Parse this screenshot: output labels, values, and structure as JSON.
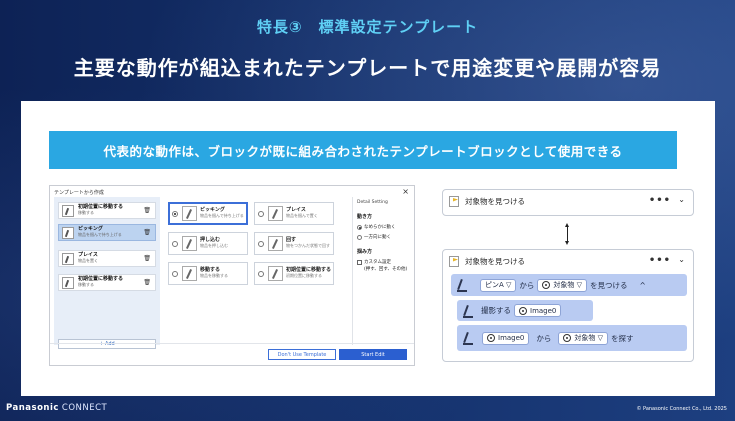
{
  "slide": {
    "subtitle": "特長③　標準設定テンプレート",
    "headline": "主要な動作が組込まれたテンプレートで用途変更や展開が容易",
    "banner": "代表的な動作は、ブロックが既に組み合わされたテンプレートブロックとして使用できる"
  },
  "dialog": {
    "title": "テンプレートから作成",
    "close": "×",
    "left_items": [
      {
        "label": "初期位置に移動する",
        "sub": "移動する",
        "selected": false
      },
      {
        "label": "ピッキング",
        "sub": "物品を掴んで持ち上げる",
        "selected": true
      },
      {
        "label": "プレイス",
        "sub": "物品を置く",
        "selected": false
      },
      {
        "label": "初期位置に移動する",
        "sub": "移動する",
        "selected": false
      }
    ],
    "add_label": "+ Add",
    "cards": [
      {
        "label": "ピッキング",
        "sub": "物品を掴んで持ち上げる",
        "selected": true
      },
      {
        "label": "プレイス",
        "sub": "物品を掴んで置く",
        "selected": false
      },
      {
        "label": "押し込む",
        "sub": "物品を押し込む",
        "selected": false
      },
      {
        "label": "回す",
        "sub": "物をつかんだ状態で回す",
        "selected": false
      },
      {
        "label": "移動する",
        "sub": "物品を移動する",
        "selected": false
      },
      {
        "label": "初期位置に移動する",
        "sub": "初期位置に移動する",
        "selected": false
      }
    ],
    "settings": {
      "header": "Detail Setting",
      "motion_label": "動き方",
      "motion_options": [
        "なめらかに動く",
        "一方向に動く"
      ],
      "grip_label": "掴み方",
      "custom_label": "カスタム設定",
      "custom_sub": "(押す、回す、その他)"
    },
    "btn_no_template": "Don't Use Template",
    "btn_start": "Start Edit"
  },
  "blocks": {
    "top_title": "対象物を見つける",
    "bottom_title": "対象物を見つける",
    "more": "•••",
    "chevron": "⌄",
    "row1": {
      "pin": "ピンA ▽",
      "from": "から",
      "target": "対象物 ▽",
      "find": "を見つける",
      "caret": "^"
    },
    "row2": {
      "shoot": "撮影する",
      "image": "Image0"
    },
    "row3": {
      "image": "Image0",
      "from": "から",
      "target": "対象物 ▽",
      "search": "を探す"
    }
  },
  "footer": {
    "brand": "Panasonic",
    "brand2": "CONNECT",
    "copyright": "© Panasonic Connect Co., Ltd. 2025"
  },
  "colors": {
    "banner": "#2aa7e2",
    "subtitle": "#5fd0f5",
    "primary_button": "#2b5fd0",
    "block_row": "#b9cbf2"
  }
}
